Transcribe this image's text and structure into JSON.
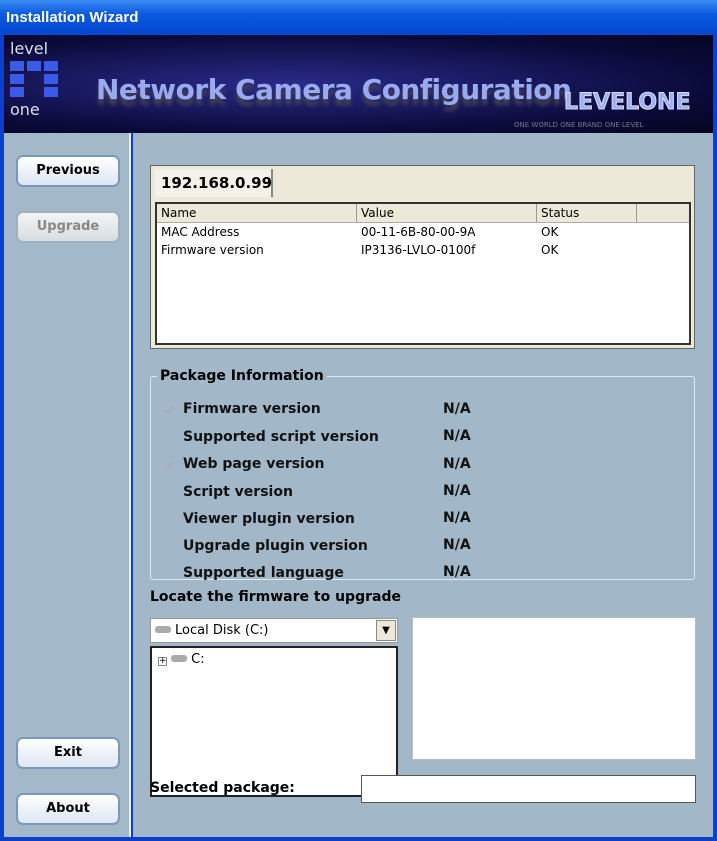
{
  "window": {
    "title": "Installation Wizard"
  },
  "banner": {
    "logo_top": "level",
    "logo_bottom": "one",
    "title": "Network Camera Configuration",
    "brand": "LEVELONE",
    "tagline": "ONE WORLD ONE BRAND ONE LEVEL"
  },
  "sidebar": {
    "previous": "Previous",
    "upgrade": "Upgrade",
    "exit": "Exit",
    "about": "About"
  },
  "device": {
    "tab": "192.168.0.99",
    "columns": [
      "Name",
      "Value",
      "Status"
    ],
    "rows": [
      {
        "name": "MAC Address",
        "value": "00-11-6B-80-00-9A",
        "status": "OK"
      },
      {
        "name": "Firmware version",
        "value": "IP3136-LVLO-0100f",
        "status": "OK"
      }
    ]
  },
  "package": {
    "legend": "Package Information",
    "items": [
      {
        "label": "Firmware version",
        "value": "N/A",
        "checked": true
      },
      {
        "label": "Supported script version",
        "value": "N/A"
      },
      {
        "label": "Web page version",
        "value": "N/A",
        "checked": true
      },
      {
        "label": "Script version",
        "value": "N/A"
      },
      {
        "label": "Viewer plugin version",
        "value": "N/A"
      },
      {
        "label": "Upgrade plugin version",
        "value": "N/A"
      },
      {
        "label": "Supported language",
        "value": "N/A"
      }
    ]
  },
  "locate": {
    "label": "Locate the firmware to upgrade",
    "drive": "Local Disk (C:)",
    "tree_root": "C:",
    "selected_label": "Selected package:",
    "selected_value": ""
  }
}
